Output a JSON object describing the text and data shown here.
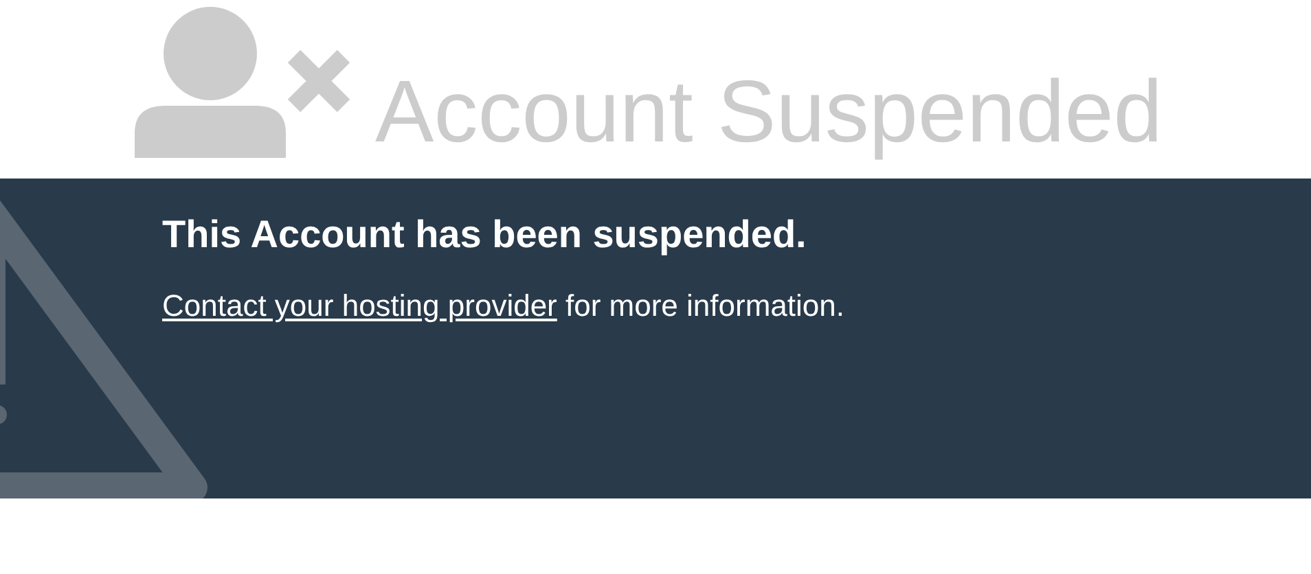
{
  "header": {
    "title": "Account Suspended"
  },
  "notice": {
    "heading": "This Account has been suspended.",
    "link": "Contact your hosting provider",
    "message": "for more information."
  }
}
